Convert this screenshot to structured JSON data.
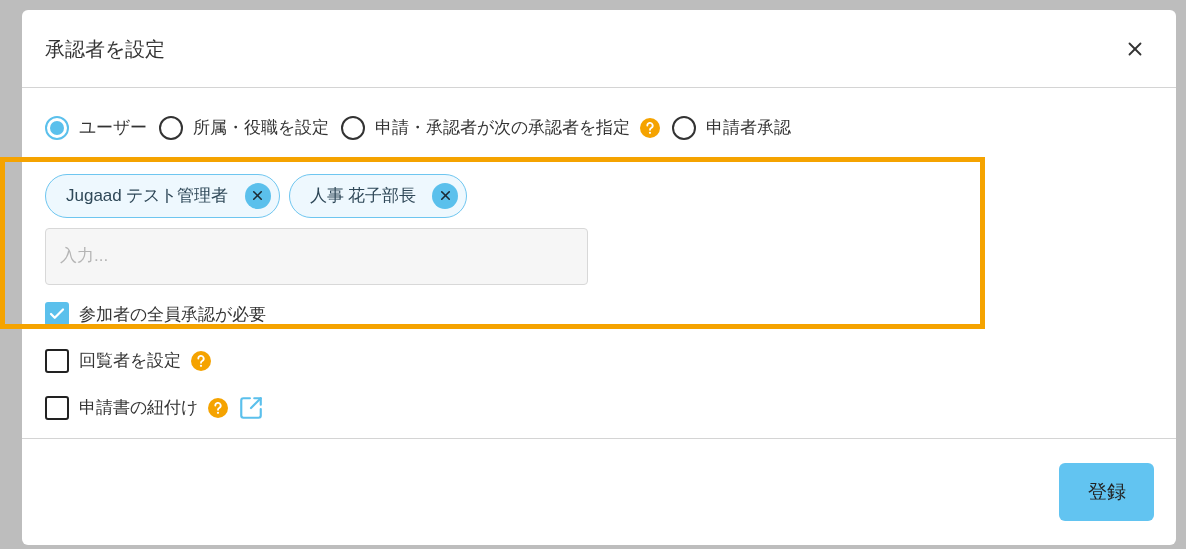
{
  "dialog": {
    "title": "承認者を設定",
    "approver_types": [
      {
        "label": "ユーザー",
        "selected": true,
        "help": false
      },
      {
        "label": "所属・役職を設定",
        "selected": false,
        "help": false
      },
      {
        "label": "申請・承認者が次の承認者を指定",
        "selected": false,
        "help": true
      },
      {
        "label": "申請者承認",
        "selected": false,
        "help": false
      }
    ],
    "chips": [
      {
        "label": "Jugaad テスト管理者"
      },
      {
        "label": "人事 花子部長"
      }
    ],
    "input": {
      "placeholder": "入力..."
    },
    "require_all": {
      "label": "参加者の全員承認が必要",
      "checked": true
    },
    "options": [
      {
        "label": "回覧者を設定",
        "checked": false,
        "help": true,
        "link": false
      },
      {
        "label": "申請書の紐付け",
        "checked": false,
        "help": true,
        "link": true
      }
    ],
    "submit": "登録"
  }
}
